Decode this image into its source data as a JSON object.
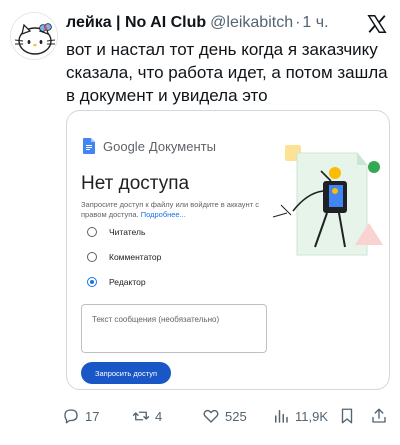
{
  "tweet": {
    "author": {
      "display_name": "лейка | No AI Club",
      "handle": "@leikabitch",
      "separator": "·",
      "time": "1 ч."
    },
    "text": "вот и настал тот день когда я заказчику сказала, что работа идет, а потом зашла в документ и увидела это",
    "icons": {
      "avatar": "hello-kitty-avatar",
      "menu": "x-logo-icon"
    }
  },
  "screenshot": {
    "brand": {
      "google": "Google",
      "product": "Документы"
    },
    "title": "Нет доступа",
    "description": "Запросите доступ к файлу или войдите в аккаунт с правом доступа.",
    "more_link": "Подробнее...",
    "roles": [
      {
        "label": "Читатель",
        "selected": false
      },
      {
        "label": "Комментатор",
        "selected": false
      },
      {
        "label": "Редактор",
        "selected": true
      }
    ],
    "message_placeholder": "Текст сообщения (необязательно)",
    "request_button": "Запросить доступ",
    "colors": {
      "accent": "#1a73e8",
      "button": "#1a57c6"
    }
  },
  "actions": {
    "replies": "17",
    "retweets": "4",
    "likes": "525",
    "views": "11,9K"
  }
}
